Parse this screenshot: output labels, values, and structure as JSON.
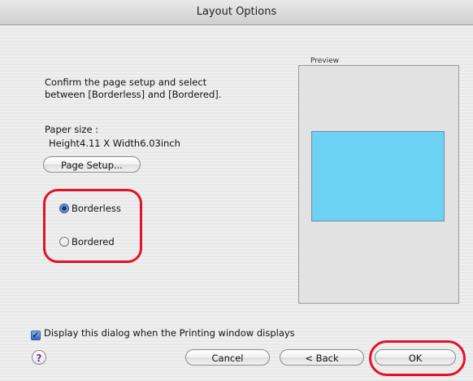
{
  "window": {
    "title": "Layout Options"
  },
  "instructions": {
    "line1": "Confirm the page setup and select",
    "line2": "between [Borderless] and [Bordered]."
  },
  "paper": {
    "label": "Paper size :",
    "value": "Height4.11 X Width6.03inch"
  },
  "buttons": {
    "page_setup": "Page Setup...",
    "cancel": "Cancel",
    "back": "< Back",
    "ok": "OK"
  },
  "layout_options": {
    "borderless": "Borderless",
    "bordered": "Bordered",
    "selected": "Borderless"
  },
  "preview": {
    "label": "Preview",
    "paper_color": "#6cd1f2"
  },
  "display_dialog": {
    "checked": true,
    "label": "Display this dialog when the Printing window displays"
  },
  "help": {
    "icon": "question-help-icon",
    "glyph": "?"
  },
  "annotations": {
    "color": "#e3122b"
  }
}
